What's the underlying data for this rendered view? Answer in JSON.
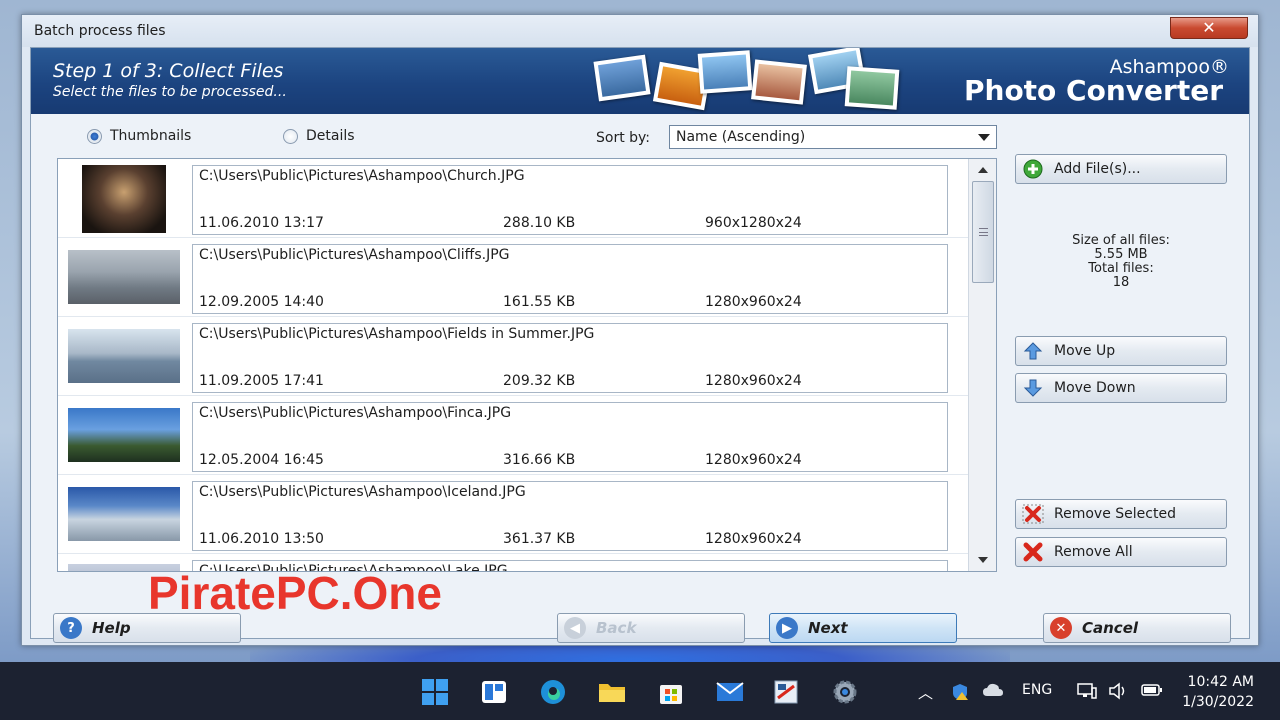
{
  "window": {
    "title": "Batch process files",
    "close_glyph": "✕"
  },
  "banner": {
    "step_title": "Step 1 of 3: Collect Files",
    "step_subtitle": "Select the files to be processed...",
    "brand_top": "Ashampoo®",
    "brand_main": "Photo Converter"
  },
  "view": {
    "thumbnails_label": "Thumbnails",
    "details_label": "Details",
    "selected": "Thumbnails"
  },
  "sort": {
    "label": "Sort by:",
    "value": "Name (Ascending)"
  },
  "files": [
    {
      "path": "C:\\Users\\Public\\Pictures\\Ashampoo\\Church.JPG",
      "date": "11.06.2010 13:17",
      "size": "288.10 KB",
      "dims": "960x1280x24"
    },
    {
      "path": "C:\\Users\\Public\\Pictures\\Ashampoo\\Cliffs.JPG",
      "date": "12.09.2005 14:40",
      "size": "161.55 KB",
      "dims": "1280x960x24"
    },
    {
      "path": "C:\\Users\\Public\\Pictures\\Ashampoo\\Fields in Summer.JPG",
      "date": "11.09.2005 17:41",
      "size": "209.32 KB",
      "dims": "1280x960x24"
    },
    {
      "path": "C:\\Users\\Public\\Pictures\\Ashampoo\\Finca.JPG",
      "date": "12.05.2004 16:45",
      "size": "316.66 KB",
      "dims": "1280x960x24"
    },
    {
      "path": "C:\\Users\\Public\\Pictures\\Ashampoo\\Iceland.JPG",
      "date": "11.06.2010 13:50",
      "size": "361.37 KB",
      "dims": "1280x960x24"
    },
    {
      "path": "C:\\Users\\Public\\Pictures\\Ashampoo\\Lake.JPG",
      "date": "",
      "size": "",
      "dims": ""
    }
  ],
  "side": {
    "add_files": "Add File(s)...",
    "size_label": "Size of all files:",
    "size_value": "5.55 MB",
    "total_label": "Total files:",
    "total_value": "18",
    "move_up": "Move Up",
    "move_down": "Move Down",
    "remove_selected": "Remove Selected",
    "remove_all": "Remove All"
  },
  "footer": {
    "help": "Help",
    "back": "Back",
    "next": "Next",
    "cancel": "Cancel"
  },
  "watermark": "PiratePC.One",
  "taskbar": {
    "language": "ENG",
    "time": "10:42 AM",
    "date": "1/30/2022"
  },
  "colors": {
    "banner": "#1c4480",
    "watermark": "#e8362c",
    "taskbar": "#1c2231"
  }
}
